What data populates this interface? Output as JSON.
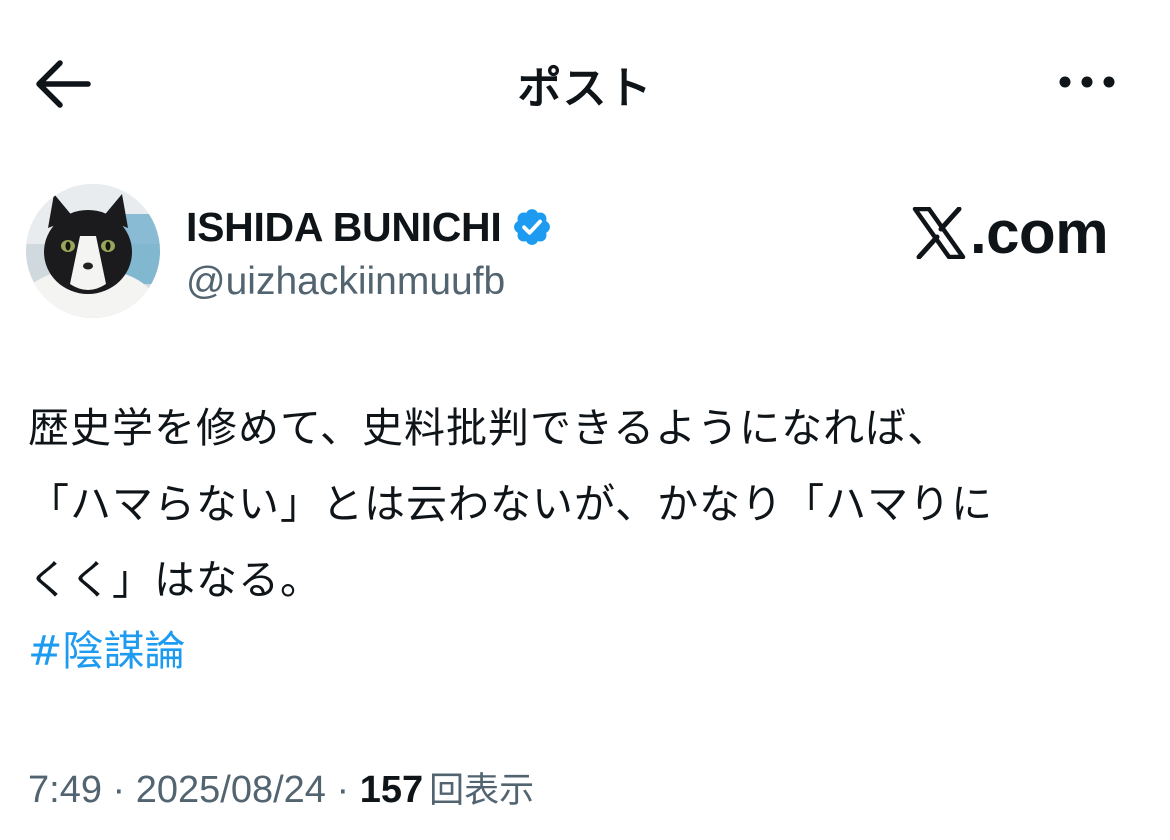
{
  "header": {
    "title": "ポスト",
    "back_icon": "arrow-left-icon",
    "more_icon": "more-horizontal-icon"
  },
  "author": {
    "display_name": "ISHIDA BUNICHI",
    "handle": "@uizhackiinmuufb",
    "verified": true,
    "verified_color": "#1d9bf0",
    "avatar": "cat-avatar"
  },
  "source": {
    "logo_text": ".com",
    "logo_icon": "x-logo-icon"
  },
  "tweet": {
    "lines": [
      "歴史学を修めて、史料批判できるようになれば、",
      "「ハマらない」とは云わないが、かなり「ハマりに",
      "くく」はなる。"
    ],
    "hashtag": "#陰謀論"
  },
  "meta": {
    "time": "7:49",
    "separator": " · ",
    "date": "2025/08/24",
    "views_count": "157",
    "views_label": "回表示"
  },
  "colors": {
    "text": "#0f1419",
    "secondary": "#536471",
    "accent": "#1d9bf0",
    "background": "#ffffff"
  }
}
